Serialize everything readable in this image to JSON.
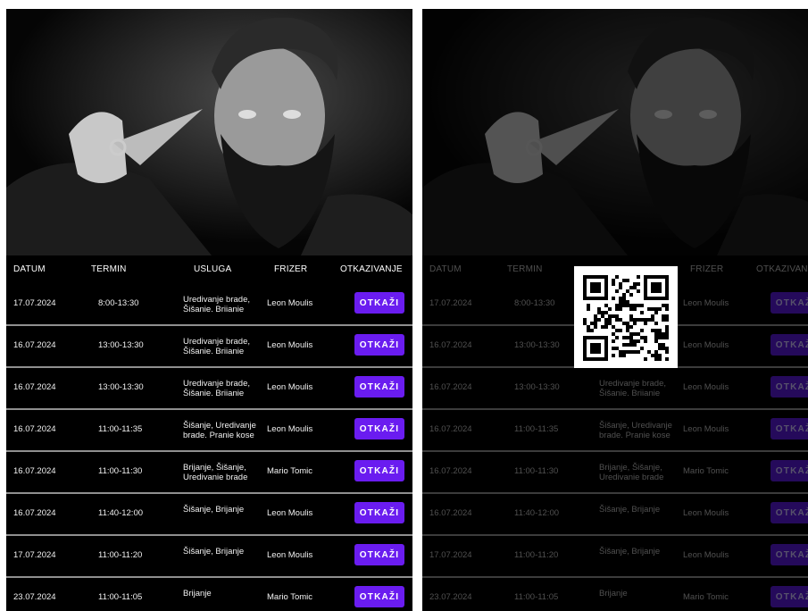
{
  "table": {
    "headers": [
      "DATUM",
      "TERMIN",
      "USLUGA",
      "FRIZER",
      "OTKAZIVANJE"
    ],
    "cancel_label": "OTKAŽI",
    "rows": [
      {
        "date": "17.07.2024",
        "time": "8:00-13:30",
        "service": "Uredivanje brade, Šišanie. Briianie",
        "barber": "Leon Moulis"
      },
      {
        "date": "16.07.2024",
        "time": "13:00-13:30",
        "service": "Uredivanje brade, Šišanie. Briianie",
        "barber": "Leon Moulis"
      },
      {
        "date": "16.07.2024",
        "time": "13:00-13:30",
        "service": "Uredivanje brade, Šišanie. Briianie",
        "barber": "Leon Moulis"
      },
      {
        "date": "16.07.2024",
        "time": "11:00-11:35",
        "service": "Šišanje, Uredivanje brade. Pranie kose",
        "barber": "Leon Moulis"
      },
      {
        "date": "16.07.2024",
        "time": "11:00-11:30",
        "service": "Brijanje, Šišanje, Uredivanie brade",
        "barber": "Mario Tomic"
      },
      {
        "date": "16.07.2024",
        "time": "11:40-12:00",
        "service": "Šišanje, Brijanje",
        "barber": "Leon Moulis"
      },
      {
        "date": "17.07.2024",
        "time": "11:00-11:20",
        "service": "Šišanje, Brijanje",
        "barber": "Leon Moulis"
      },
      {
        "date": "23.07.2024",
        "time": "11:00-11:05",
        "service": "Brijanje",
        "barber": "Mario Tomic"
      }
    ]
  },
  "overlay": {
    "last_row_time": "11:00-11:05",
    "qr_icon": "qr-code-icon"
  },
  "colors": {
    "accent": "#6a1cf0",
    "background": "#000000",
    "row_divider": "#8f8f8f"
  }
}
